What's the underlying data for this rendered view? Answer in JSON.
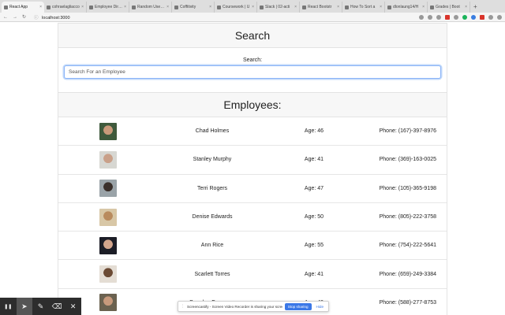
{
  "browser": {
    "tabs": [
      {
        "label": "React App",
        "active": true
      },
      {
        "label": "cohraelagliacco",
        "active": false
      },
      {
        "label": "Employee Direc",
        "active": false
      },
      {
        "label": "Random User G",
        "active": false
      },
      {
        "label": "Coffitivity",
        "active": false
      },
      {
        "label": "Coursework | U",
        "active": false
      },
      {
        "label": "Slack | 02-acti",
        "active": false
      },
      {
        "label": "React Bootstr",
        "active": false
      },
      {
        "label": "How To Sort a",
        "active": false
      },
      {
        "label": "dlonlaung14/H",
        "active": false
      },
      {
        "label": "Grades | Boot",
        "active": false
      }
    ],
    "tab_close": "×",
    "new_tab": "+",
    "url": "localhost:3000",
    "nav": {
      "back": "←",
      "forward": "→",
      "reload": "↻",
      "lock": "ⓘ"
    }
  },
  "search_card": {
    "title": "Search",
    "label": "Search:",
    "placeholder": "Search For an Employee",
    "value": ""
  },
  "employees_card": {
    "title": "Employees:",
    "employees": [
      {
        "name": "Chad Holmes",
        "age": "Age: 46",
        "phone": "Phone: (167)-397-8976",
        "avatar_colors": [
          "#3f5a3c",
          "#c99a7a"
        ]
      },
      {
        "name": "Stanley Murphy",
        "age": "Age: 41",
        "phone": "Phone: (369)-163-0025",
        "avatar_colors": [
          "#d7d7d2",
          "#c9a089"
        ]
      },
      {
        "name": "Terri Rogers",
        "age": "Age: 47",
        "phone": "Phone: (105)-365-9198",
        "avatar_colors": [
          "#9aa3a8",
          "#3a2f2a"
        ]
      },
      {
        "name": "Denise Edwards",
        "age": "Age: 50",
        "phone": "Phone: (805)-222-3758",
        "avatar_colors": [
          "#d8c7a6",
          "#b98b5e"
        ]
      },
      {
        "name": "Ann Rice",
        "age": "Age: 55",
        "phone": "Phone: (754)-222-5641",
        "avatar_colors": [
          "#1c1d26",
          "#d2a58c"
        ]
      },
      {
        "name": "Scarlett Torres",
        "age": "Age: 41",
        "phone": "Phone: (659)-249-3384",
        "avatar_colors": [
          "#e4ddd4",
          "#6b4a34"
        ]
      },
      {
        "name": "Brayden Ferguson",
        "age": "Age: 49",
        "phone": "Phone: (588)-277-8753",
        "avatar_colors": [
          "#6b6250",
          "#c89a7c"
        ]
      }
    ]
  },
  "toolbar": {
    "pause": "❚❚",
    "pointer": "➤",
    "pen": "✎",
    "eraser": "⌫",
    "close": "✕"
  },
  "share_banner": {
    "text": "Screencastify - Screen Video Recorder is sharing your screen.",
    "stop_label": "Stop sharing",
    "hide_label": "Hide"
  }
}
